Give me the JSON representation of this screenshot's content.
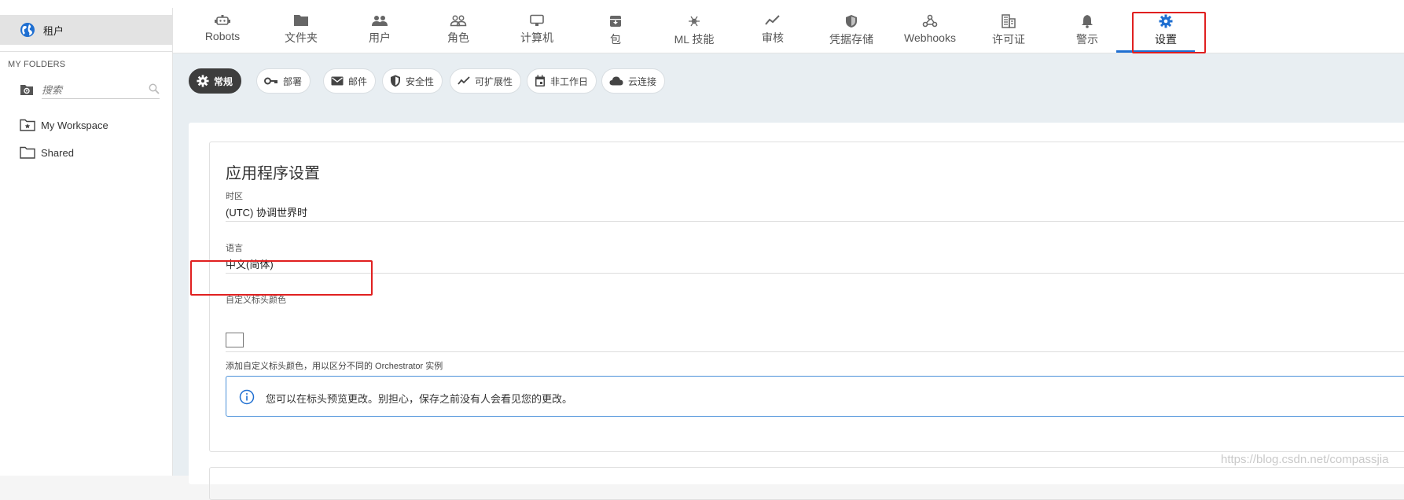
{
  "sidebar": {
    "tenant_label": "租户",
    "section_title": "MY FOLDERS",
    "search_placeholder": "搜索",
    "folders": [
      {
        "label": "My Workspace",
        "icon": "folder-star-icon"
      },
      {
        "label": "Shared",
        "icon": "folder-icon"
      }
    ]
  },
  "nav": {
    "items": [
      {
        "label": "Robots",
        "icon": "robot-icon"
      },
      {
        "label": "文件夹",
        "icon": "folder-icon"
      },
      {
        "label": "用户",
        "icon": "users-icon"
      },
      {
        "label": "角色",
        "icon": "roles-icon"
      },
      {
        "label": "计算机",
        "icon": "monitor-icon"
      },
      {
        "label": "包",
        "icon": "package-icon"
      },
      {
        "label": "ML 技能",
        "icon": "ml-skills-icon"
      },
      {
        "label": "审核",
        "icon": "audit-trend-icon"
      },
      {
        "label": "凭据存储",
        "icon": "shield-icon"
      },
      {
        "label": "Webhooks",
        "icon": "webhook-icon"
      },
      {
        "label": "许可证",
        "icon": "license-building-icon"
      },
      {
        "label": "警示",
        "icon": "bell-icon"
      },
      {
        "label": "设置",
        "icon": "gear-icon"
      }
    ],
    "active": "设置"
  },
  "tabs": [
    {
      "label": "常规",
      "icon": "gear-icon",
      "active": true
    },
    {
      "label": "部署",
      "icon": "key-icon"
    },
    {
      "label": "邮件",
      "icon": "mail-icon"
    },
    {
      "label": "安全性",
      "icon": "shield-icon"
    },
    {
      "label": "可扩展性",
      "icon": "trend-icon"
    },
    {
      "label": "非工作日",
      "icon": "calendar-icon"
    },
    {
      "label": "云连接",
      "icon": "cloud-icon"
    }
  ],
  "settings": {
    "title": "应用程序设置",
    "timezone_label": "时区",
    "timezone_value": "(UTC) 协调世界时",
    "language_label": "语言",
    "language_value": "中文(简体)",
    "header_color_label": "自定义标头颜色",
    "header_color_hint": "添加自定义标头颜色，用以区分不同的 Orchestrator 实例",
    "info_message": "您可以在标头预览更改。别担心，保存之前没有人会看见您的更改。"
  },
  "watermark": "https://blog.csdn.net/compassjia",
  "colors": {
    "accent": "#1f6fd1",
    "highlight_box": "#e02020",
    "active_tab_bg": "#3d3d3d",
    "info_border": "#4a90d9"
  }
}
